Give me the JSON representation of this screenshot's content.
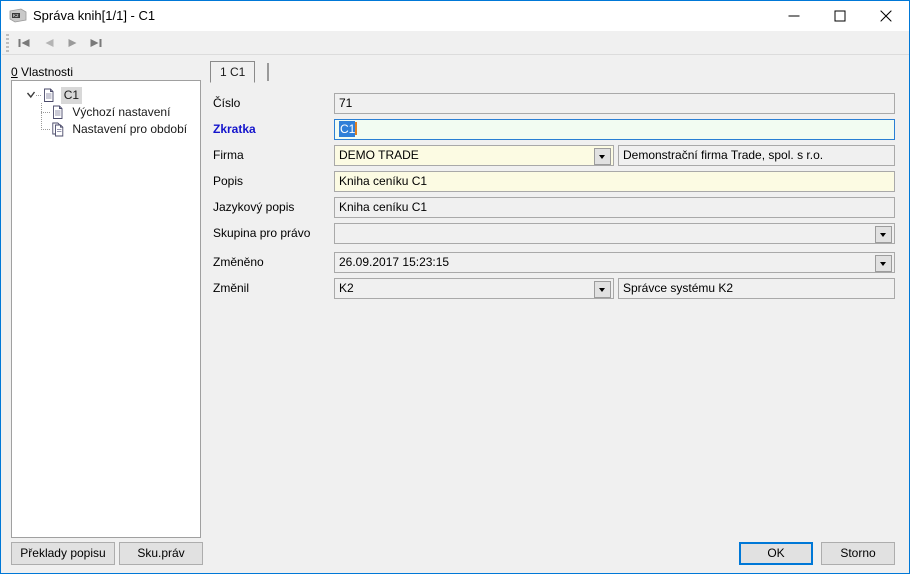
{
  "window": {
    "title": "Správa knih[1/1] - C1",
    "app_icon": "k2-app-icon",
    "controls": {
      "minimize": "minimize-icon",
      "maximize": "maximize-icon",
      "close": "close-icon"
    },
    "accent_color": "#0078d7",
    "background_color": "#f0f0f0"
  },
  "toolbar": {
    "buttons": [
      {
        "name": "first-record",
        "icon": "first-record-icon"
      },
      {
        "name": "previous-record",
        "icon": "previous-record-icon"
      },
      {
        "name": "next-record",
        "icon": "next-record-icon"
      },
      {
        "name": "last-record",
        "icon": "last-record-icon"
      }
    ]
  },
  "tree": {
    "label_accel": "0",
    "label_text": " Vlastnosti",
    "nodes": [
      {
        "label": "C1",
        "icon": "document-icon",
        "expanded": true,
        "selected": true
      },
      {
        "label": "Výchozí nastavení",
        "icon": "document-icon",
        "expanded": false,
        "selected": false
      },
      {
        "label": "Nastavení pro období",
        "icon": "documents-icon",
        "expanded": false,
        "selected": false
      }
    ]
  },
  "tabs": [
    {
      "label": "1 C1",
      "active": true
    }
  ],
  "form": {
    "rows": [
      {
        "label": "Číslo",
        "required": false,
        "value": "71",
        "state": "readonly",
        "dropdown": false,
        "secondary": null
      },
      {
        "label": "Zkratka",
        "required": true,
        "value": "C1",
        "state": "focused",
        "dropdown": false,
        "secondary": null
      },
      {
        "label": "Firma",
        "required": false,
        "value": "DEMO TRADE",
        "state": "edit",
        "dropdown": true,
        "secondary": "Demonstrační firma Trade, spol. s r.o."
      },
      {
        "label": "Popis",
        "required": false,
        "value": "Kniha ceníku C1",
        "state": "edit",
        "dropdown": false,
        "secondary": null
      },
      {
        "label": "Jazykový popis",
        "required": false,
        "value": "Kniha ceníku C1",
        "state": "readonly",
        "dropdown": false,
        "secondary": null
      },
      {
        "label": "Skupina pro právo",
        "required": false,
        "value": "",
        "state": "readonly",
        "dropdown": true,
        "secondary": null
      },
      {
        "label": "Změněno",
        "required": false,
        "value": "26.09.2017 15:23:15",
        "state": "readonly",
        "dropdown": true,
        "secondary": null
      },
      {
        "label": "Změnil",
        "required": false,
        "value": "K2",
        "state": "readonly",
        "dropdown": true,
        "secondary": "Správce systému K2"
      }
    ]
  },
  "buttons": {
    "preklady_popisu": "Překlady popisu",
    "sku_prav": "Sku.práv",
    "ok": "OK",
    "storno": "Storno"
  }
}
